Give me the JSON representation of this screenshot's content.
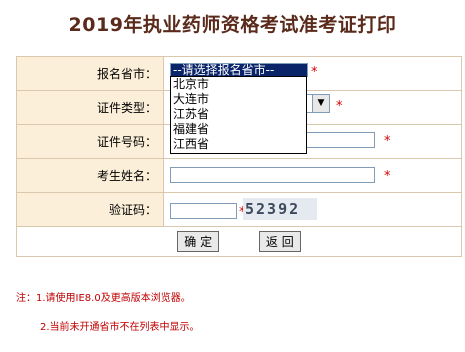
{
  "title": "2019年执业药师资格考试准考证打印",
  "form": {
    "province": {
      "label": "报名省市：",
      "selected": "--请选择报名省市--",
      "options": [
        "北京市",
        "大连市",
        "江苏省",
        "福建省",
        "江西省"
      ]
    },
    "id_type": {
      "label": "证件类型："
    },
    "id_number": {
      "label": "证件号码："
    },
    "name": {
      "label": "考生姓名："
    },
    "captcha": {
      "label": "验证码：",
      "image_text": "52392"
    },
    "required_mark": "*"
  },
  "buttons": {
    "confirm": "确 定",
    "back": "返 回"
  },
  "notes": {
    "line1": "注：1.请使用IE8.0及更高版本浏览器。",
    "line2": "2.当前未开通省市不在列表中显示。"
  },
  "colors": {
    "title": "#5a2a1b",
    "label_bg": "#fbefd9",
    "required": "#d40000"
  }
}
